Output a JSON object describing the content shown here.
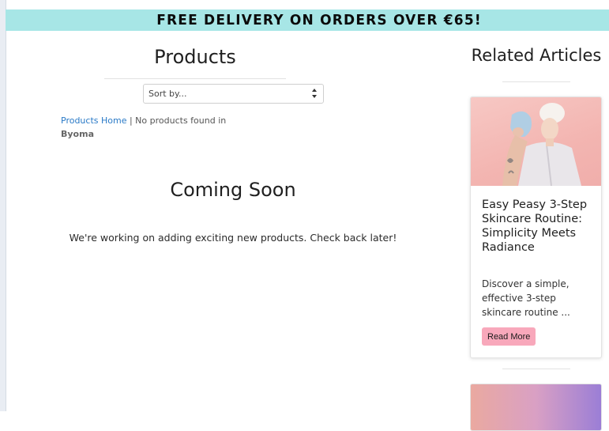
{
  "promo": {
    "text": "FREE DELIVERY ON ORDERS OVER €65!"
  },
  "products": {
    "title": "Products",
    "sort_placeholder": "Sort by...",
    "breadcrumb": {
      "home_link": "Products Home",
      "separator_text": " | No products found in",
      "brand": "Byoma"
    },
    "coming_soon_title": "Coming Soon",
    "coming_soon_message": "We're working on adding exciting new products. Check back later!"
  },
  "related": {
    "title": "Related Articles",
    "articles": [
      {
        "title": "Easy Peasy 3-Step Skincare Routine: Simplicity Meets Radiance",
        "excerpt": "Discover a simple, effective 3-step skincare routine ...",
        "button_label": "Read More"
      }
    ]
  },
  "colors": {
    "promo_bg": "#a7e6e6",
    "link": "#2a7ac7",
    "read_more_bg": "#f8a8bb"
  }
}
